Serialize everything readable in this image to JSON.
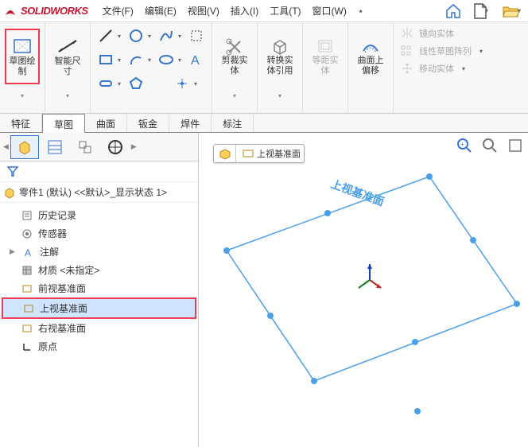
{
  "app": {
    "name": "SOLIDWORKS"
  },
  "menu": {
    "file": "文件(F)",
    "edit": "编辑(E)",
    "view": "视图(V)",
    "insert": "插入(I)",
    "tools": "工具(T)",
    "window": "窗口(W)"
  },
  "ribbon": {
    "sketch": "草图绘制",
    "smartDim": "智能尺寸",
    "trim": {
      "l1": "剪裁实",
      "l2": "体"
    },
    "convert": {
      "l1": "转换实",
      "l2": "体引用"
    },
    "offsetEnt": {
      "l1": "等距实",
      "l2": "体"
    },
    "offsetCurve": {
      "l1": "曲面上",
      "l2": "偏移"
    },
    "mirror": "镜向实体",
    "linearPattern": "线性草图阵列",
    "move": "移动实体"
  },
  "tabs": {
    "feature": "特征",
    "sketch": "草图",
    "surface": "曲面",
    "sheetmetal": "钣金",
    "weldment": "焊件",
    "annotate": "标注"
  },
  "tree": {
    "part": "零件1 (默认) <<默认>_显示状态 1>",
    "history": "历史记录",
    "sensor": "传感器",
    "annotations": "注解",
    "material": "材质 <未指定>",
    "frontPlane": "前视基准面",
    "topPlane": "上视基准面",
    "rightPlane": "右视基准面",
    "origin": "原点"
  },
  "viewport": {
    "crumb": "上视基准面",
    "planeLabel": "上视基准面"
  }
}
